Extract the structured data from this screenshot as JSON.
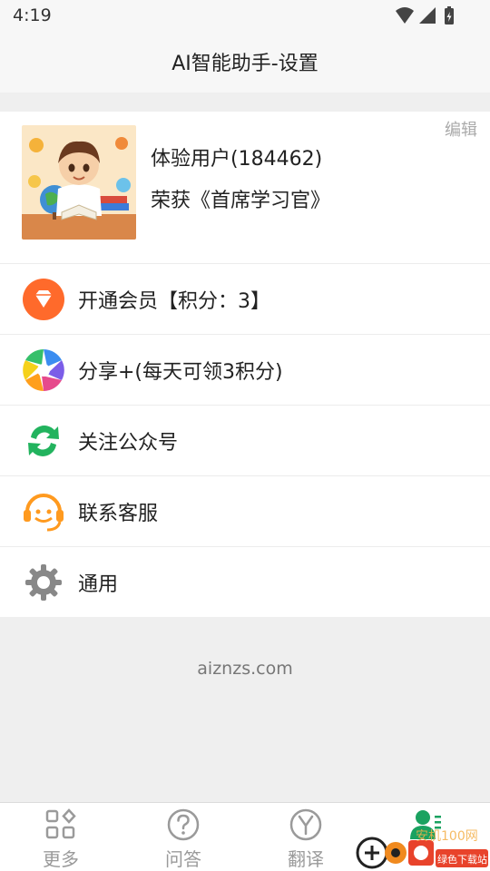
{
  "status_bar": {
    "time": "4:19"
  },
  "header": {
    "title": "AI智能助手-设置"
  },
  "profile": {
    "edit_label": "编辑",
    "name": "体验用户(184462)",
    "honor": "荣获《首席学习官》"
  },
  "menu": {
    "items": [
      {
        "label": "开通会员【积分：3】",
        "icon": "diamond-icon",
        "color": "#ff6a2b"
      },
      {
        "label": "分享+(每天可领3积分)",
        "icon": "aperture-icon",
        "color": "#3b8df0"
      },
      {
        "label": "关注公众号",
        "icon": "recycle-arrows-icon",
        "color": "#22b35e"
      },
      {
        "label": "联系客服",
        "icon": "headset-smiley-icon",
        "color": "#ff9a1f"
      },
      {
        "label": "通用",
        "icon": "gear-icon",
        "color": "#888888"
      }
    ]
  },
  "footer": {
    "domain": "aiznzs.com"
  },
  "tab_bar": {
    "tabs": [
      {
        "label": "更多",
        "icon": "grid-icon"
      },
      {
        "label": "问答",
        "icon": "question-circle-icon"
      },
      {
        "label": "翻译",
        "icon": "y-circle-icon"
      },
      {
        "label": "",
        "icon": "user-profile-icon",
        "active": true,
        "color": "#1aa260"
      }
    ]
  },
  "watermark": {
    "text": "安机100网",
    "subtext": "绿色下载站"
  }
}
